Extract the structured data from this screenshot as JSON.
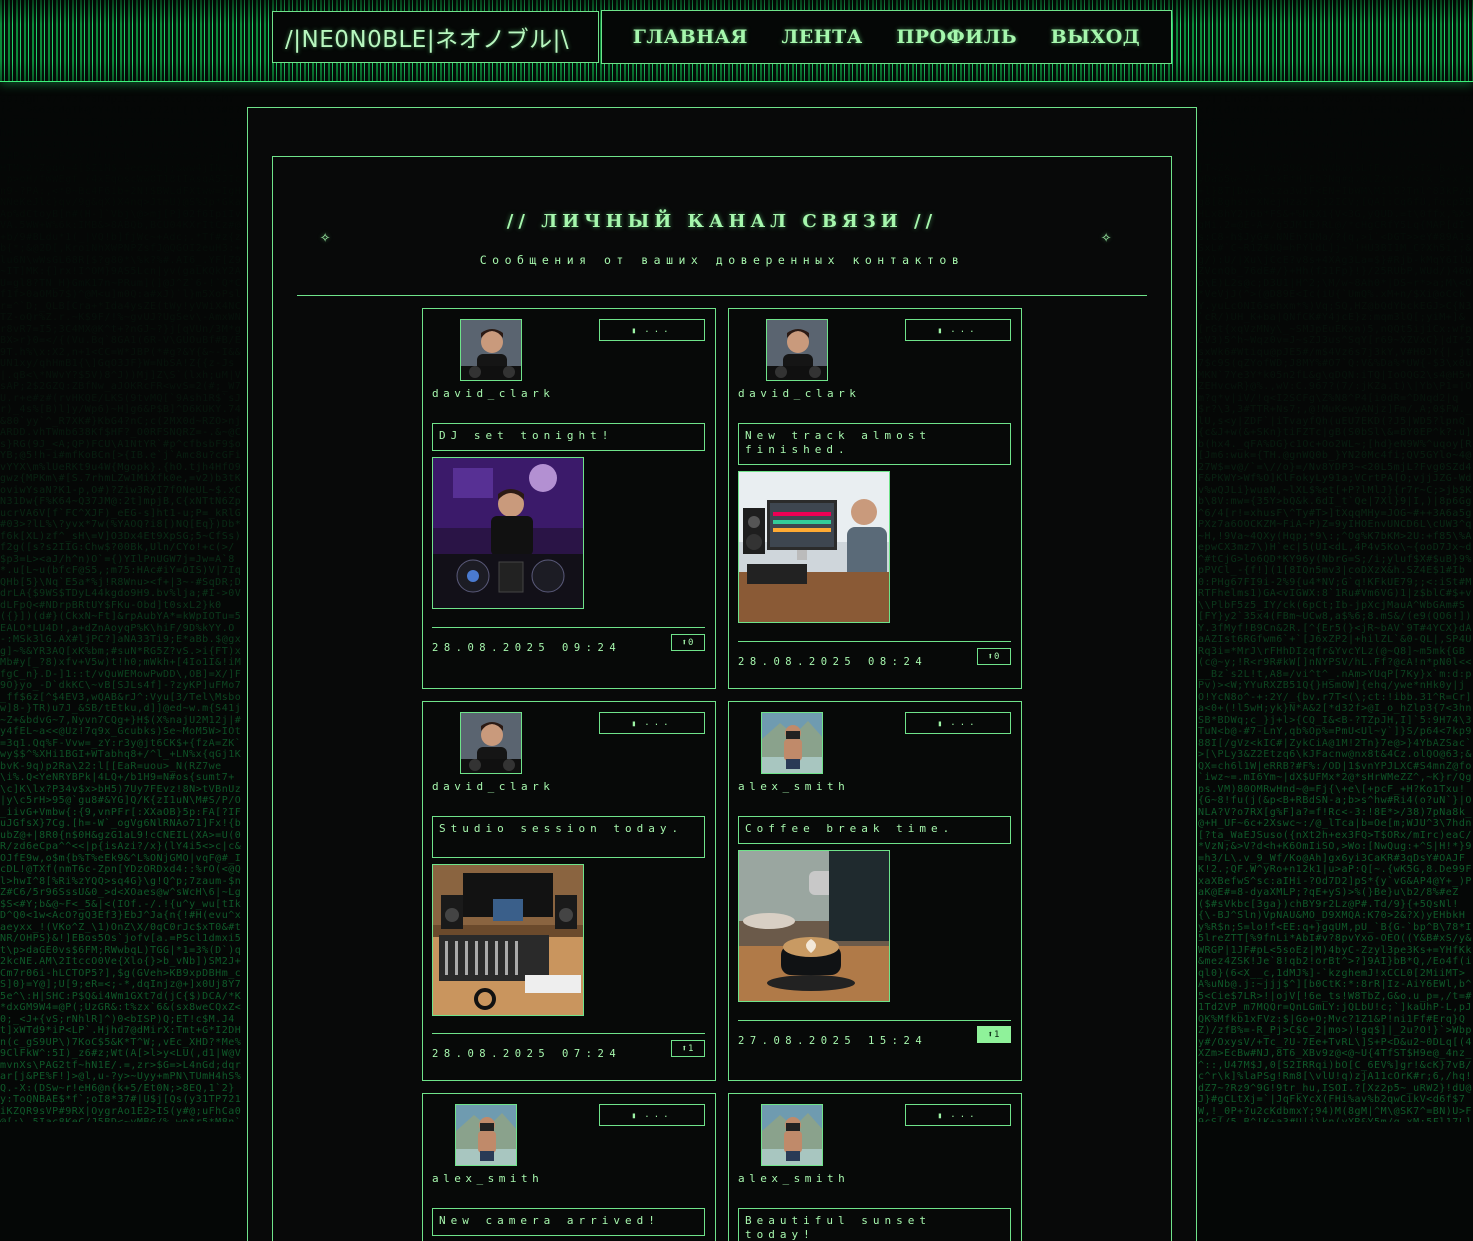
{
  "app": {
    "logo": "/|NE0N0BLE|ネオノブル|\\",
    "nav": [
      "ГЛАВНАЯ",
      "ЛЕНТА",
      "ПРОФИЛЬ",
      "ВЫХОД"
    ]
  },
  "feed": {
    "title": "// ЛИЧНЫЙ КАНАЛ СВЯЗИ //",
    "subtitle": "Сообщения от ваших доверенных контактов",
    "spark_icon": "✧"
  },
  "posts": [
    {
      "username": "david_clark",
      "text": "DJ set tonight!",
      "timestamp": "28.08.2025 09:24",
      "likes": "0",
      "menu": "...",
      "photo_icon": "dj-photo",
      "liked": false
    },
    {
      "username": "david_clark",
      "text": "New track almost finished.",
      "timestamp": "28.08.2025 08:24",
      "likes": "0",
      "menu": "...",
      "photo_icon": "studio-computer-photo",
      "liked": false
    },
    {
      "username": "david_clark",
      "text": "Studio session today.",
      "timestamp": "28.08.2025 07:24",
      "likes": "1",
      "menu": "...",
      "photo_icon": "mixing-console-photo",
      "liked": false
    },
    {
      "username": "alex_smith",
      "text": "Coffee break time.",
      "timestamp": "27.08.2025 15:24",
      "likes": "1",
      "menu": "...",
      "photo_icon": "latte-photo",
      "liked": true
    },
    {
      "username": "alex_smith",
      "text": "New camera arrived!",
      "timestamp": "",
      "likes": "",
      "menu": "...",
      "photo_icon": "camera-photo",
      "liked": false
    },
    {
      "username": "alex_smith",
      "text": "Beautiful sunset today!",
      "timestamp": "",
      "likes": "",
      "menu": "...",
      "photo_icon": "sunset-photo",
      "liked": false
    }
  ],
  "icons": {
    "menu": "chat-bubble-icon",
    "like": "up-arrow-icon"
  },
  "colors": {
    "accent": "#6fe38a",
    "text": "#a6f7ad",
    "background": "#050706",
    "like_active": "#8ff29a"
  }
}
